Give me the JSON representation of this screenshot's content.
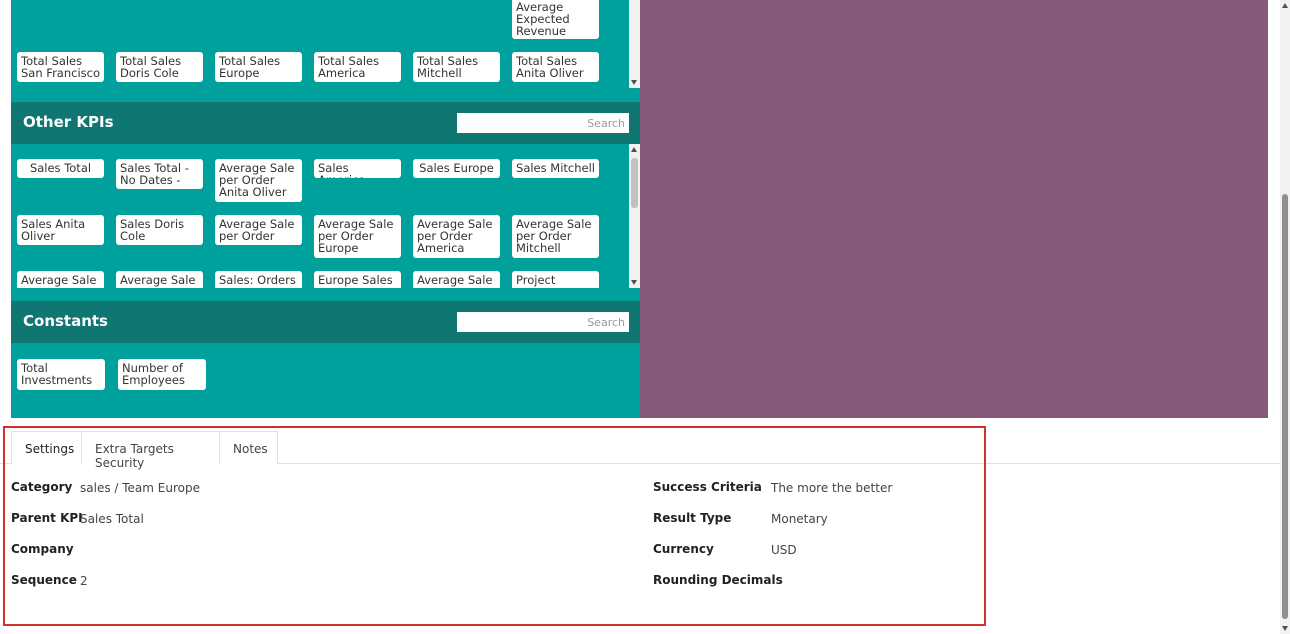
{
  "sales_section": {
    "chips": [
      "Total Sales San Francisco",
      "Total Sales Doris Cole",
      "Total Sales Europe",
      "Total Sales America",
      "Total Sales Mitchell",
      "Total Sales Anita Oliver"
    ],
    "top_chip": "Average Expected Revenue"
  },
  "other_kpis": {
    "title": "Other KPIs",
    "search_placeholder": "Search",
    "chips_row1": [
      "Sales Total",
      "Sales Total - No Dates -",
      "Average Sale per Order Anita Oliver",
      "Sales America",
      "Sales Europe",
      "Sales Mitchell"
    ],
    "chips_row2": [
      "Sales Anita Oliver",
      "Sales Doris Cole",
      "Average Sale per Order",
      "Average Sale per Order Europe",
      "Average Sale per Order America",
      "Average Sale per Order Mitchell"
    ],
    "chips_row3": [
      "Average Sale",
      "Average Sale",
      "Sales: Orders",
      "Europe Sales",
      "Average Sale",
      "Project"
    ]
  },
  "constants": {
    "title": "Constants",
    "search_placeholder": "Search",
    "chips": [
      "Total Investments",
      "Number of Employees"
    ]
  },
  "tabs": [
    {
      "label": "Settings",
      "active": true
    },
    {
      "label": "Extra Targets Security",
      "active": false
    },
    {
      "label": "Notes",
      "active": false
    }
  ],
  "form": {
    "left": [
      {
        "label": "Category",
        "value": "sales / Team Europe"
      },
      {
        "label": "Parent KPI",
        "value": "Sales Total"
      },
      {
        "label": "Company",
        "value": ""
      },
      {
        "label": "Sequence",
        "value": "2"
      }
    ],
    "right": [
      {
        "label": "Success Criteria",
        "value": "The more the better"
      },
      {
        "label": "Result Type",
        "value": "Monetary"
      },
      {
        "label": "Currency",
        "value": "USD"
      },
      {
        "label": "Rounding Decimals",
        "value": ""
      }
    ]
  },
  "colors": {
    "teal": "#00a09d",
    "teal_dark": "#107672",
    "purple": "#875a7b",
    "highlight": "#d32f2f"
  }
}
